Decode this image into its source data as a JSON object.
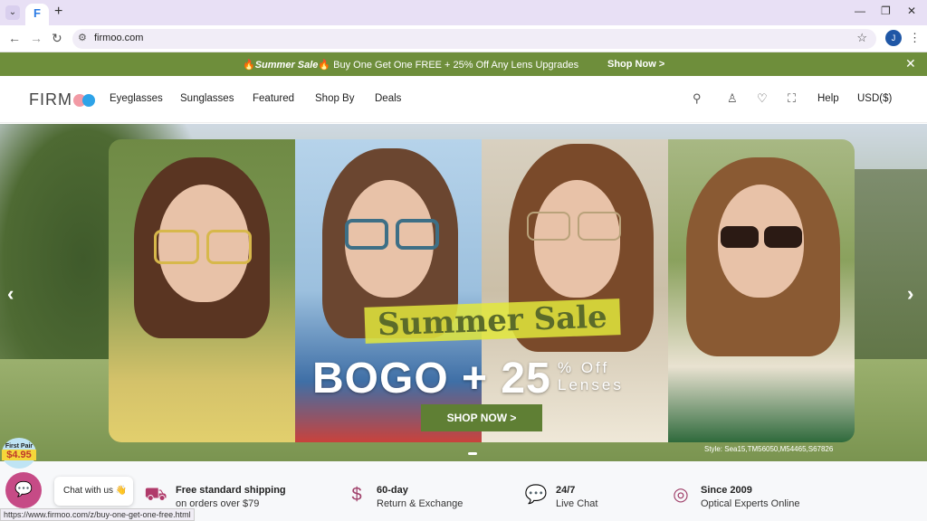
{
  "browser": {
    "tab_title": "F",
    "url": "firmoo.com",
    "profile_initial": "J"
  },
  "promo": {
    "sale_label": "Summer Sale",
    "message": "Buy One Get One FREE + 25% Off Any Lens Upgrades",
    "shop_link": "Shop Now >",
    "close": "✕"
  },
  "header": {
    "logo": "FIRM",
    "menu": [
      "Eyeglasses",
      "Sunglasses",
      "Featured",
      "Shop By",
      "Deals"
    ],
    "help": "Help",
    "currency": "USD($)"
  },
  "hero": {
    "sale_title": "Summer Sale",
    "bogo": "BOGO + 25",
    "off_line1": "% Off",
    "off_line2": "Lenses",
    "cta": "SHOP NOW >",
    "caption": "Style: Sea15,TM56050,M54465,S67826"
  },
  "features": [
    {
      "icon": "truck-icon",
      "title": "Free standard shipping",
      "sub": "on orders over $79"
    },
    {
      "icon": "dollar-icon",
      "title": "60-day",
      "sub": "Return & Exchange"
    },
    {
      "icon": "chat-icon",
      "title": "24/7",
      "sub": "Live Chat"
    },
    {
      "icon": "glasses-icon",
      "title": "Since 2009",
      "sub": "Optical Experts Online"
    }
  ],
  "badge": {
    "line1": "First Pair",
    "line2": "$4.95"
  },
  "chat": {
    "label": "Chat with us 👋"
  },
  "status_url": "https://www.firmoo.com/z/buy-one-get-one-free.html"
}
